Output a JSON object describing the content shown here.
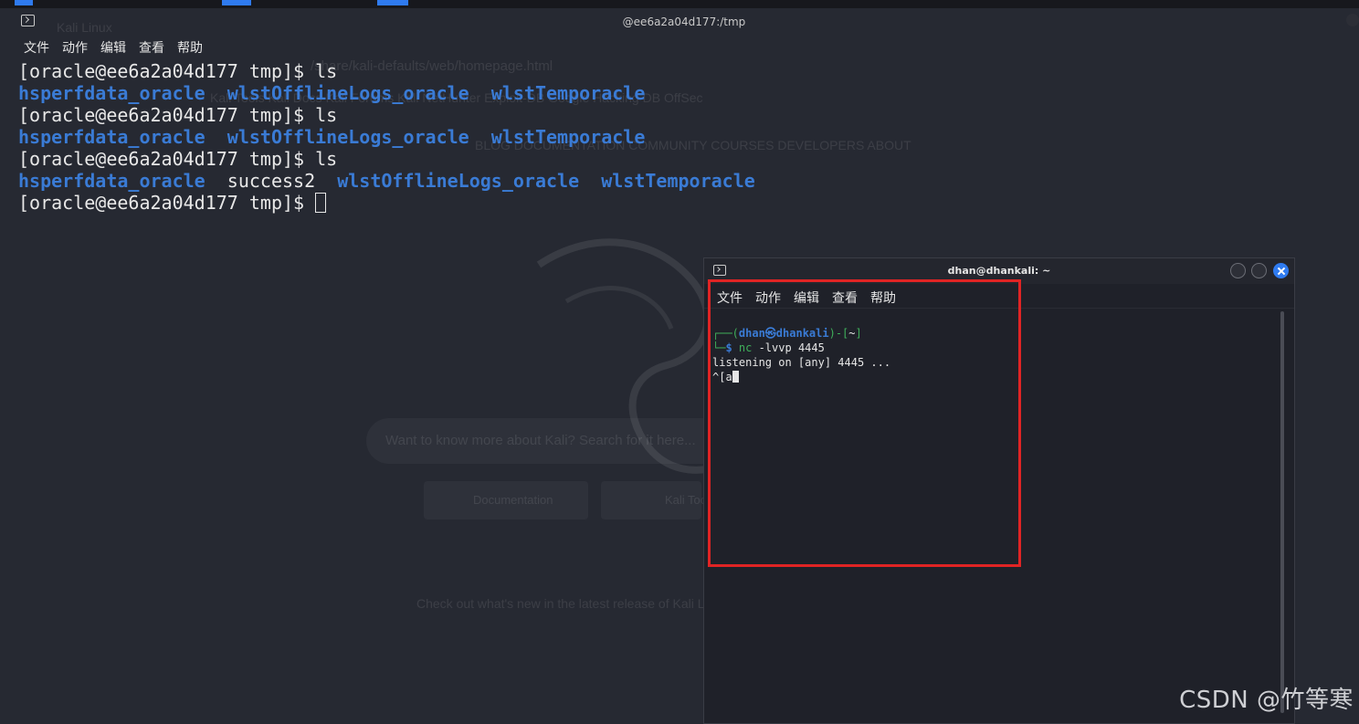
{
  "background_page": {
    "tab_label": "Kali Linux",
    "address_text": "/share/kali-defaults/web/homepage.html",
    "bookmarks_text": "Kali Tools    Kali Docs    Kali Forums    Kali NetHunter    Exploit-DB    Google Hacking DB    OffSec",
    "nav_text": "BLOG    DOCUMENTATION    COMMUNITY    COURSES    DEVELOPERS    ABOUT",
    "search_placeholder": "Want to know more about Kali? Search for it here...",
    "btn_docs": "Documentation",
    "btn_tools": "Kali Tools",
    "footer_text": "Check out what's new in the latest release of Kali Linux"
  },
  "main_terminal": {
    "title": "@ee6a2a04d177:/tmp",
    "menu": [
      "文件",
      "动作",
      "编辑",
      "查看",
      "帮助"
    ],
    "prompt": "[oracle@ee6a2a04d177 tmp]$ ",
    "cmd": "ls",
    "dir1": "hsperfdata_oracle",
    "dir2": "wlstOfflineLogs_oracle",
    "dir3": "wlstTemporacle",
    "file_success": "success2"
  },
  "overlay_terminal": {
    "title": "dhan@dhankali: ~",
    "menu": [
      "文件",
      "动作",
      "编辑",
      "查看",
      "帮助"
    ],
    "prompt_open": "┌──(",
    "prompt_user": "dhan㉿dhankali",
    "prompt_mid": ")-[",
    "prompt_path": "~",
    "prompt_close": "]",
    "prompt2_prefix": "└─",
    "prompt2_dollar": "$ ",
    "cmd_name": "nc",
    "cmd_args": " -lvvp ",
    "cmd_port": "4445",
    "listening_line": "listening on [any] 4445 ...",
    "input_line": "^[a"
  },
  "watermark": "CSDN @竹等寒",
  "colors": {
    "dir_blue": "#3a7bd5",
    "prompt_green": "#3fae5a",
    "highlight_red": "#e02424"
  }
}
